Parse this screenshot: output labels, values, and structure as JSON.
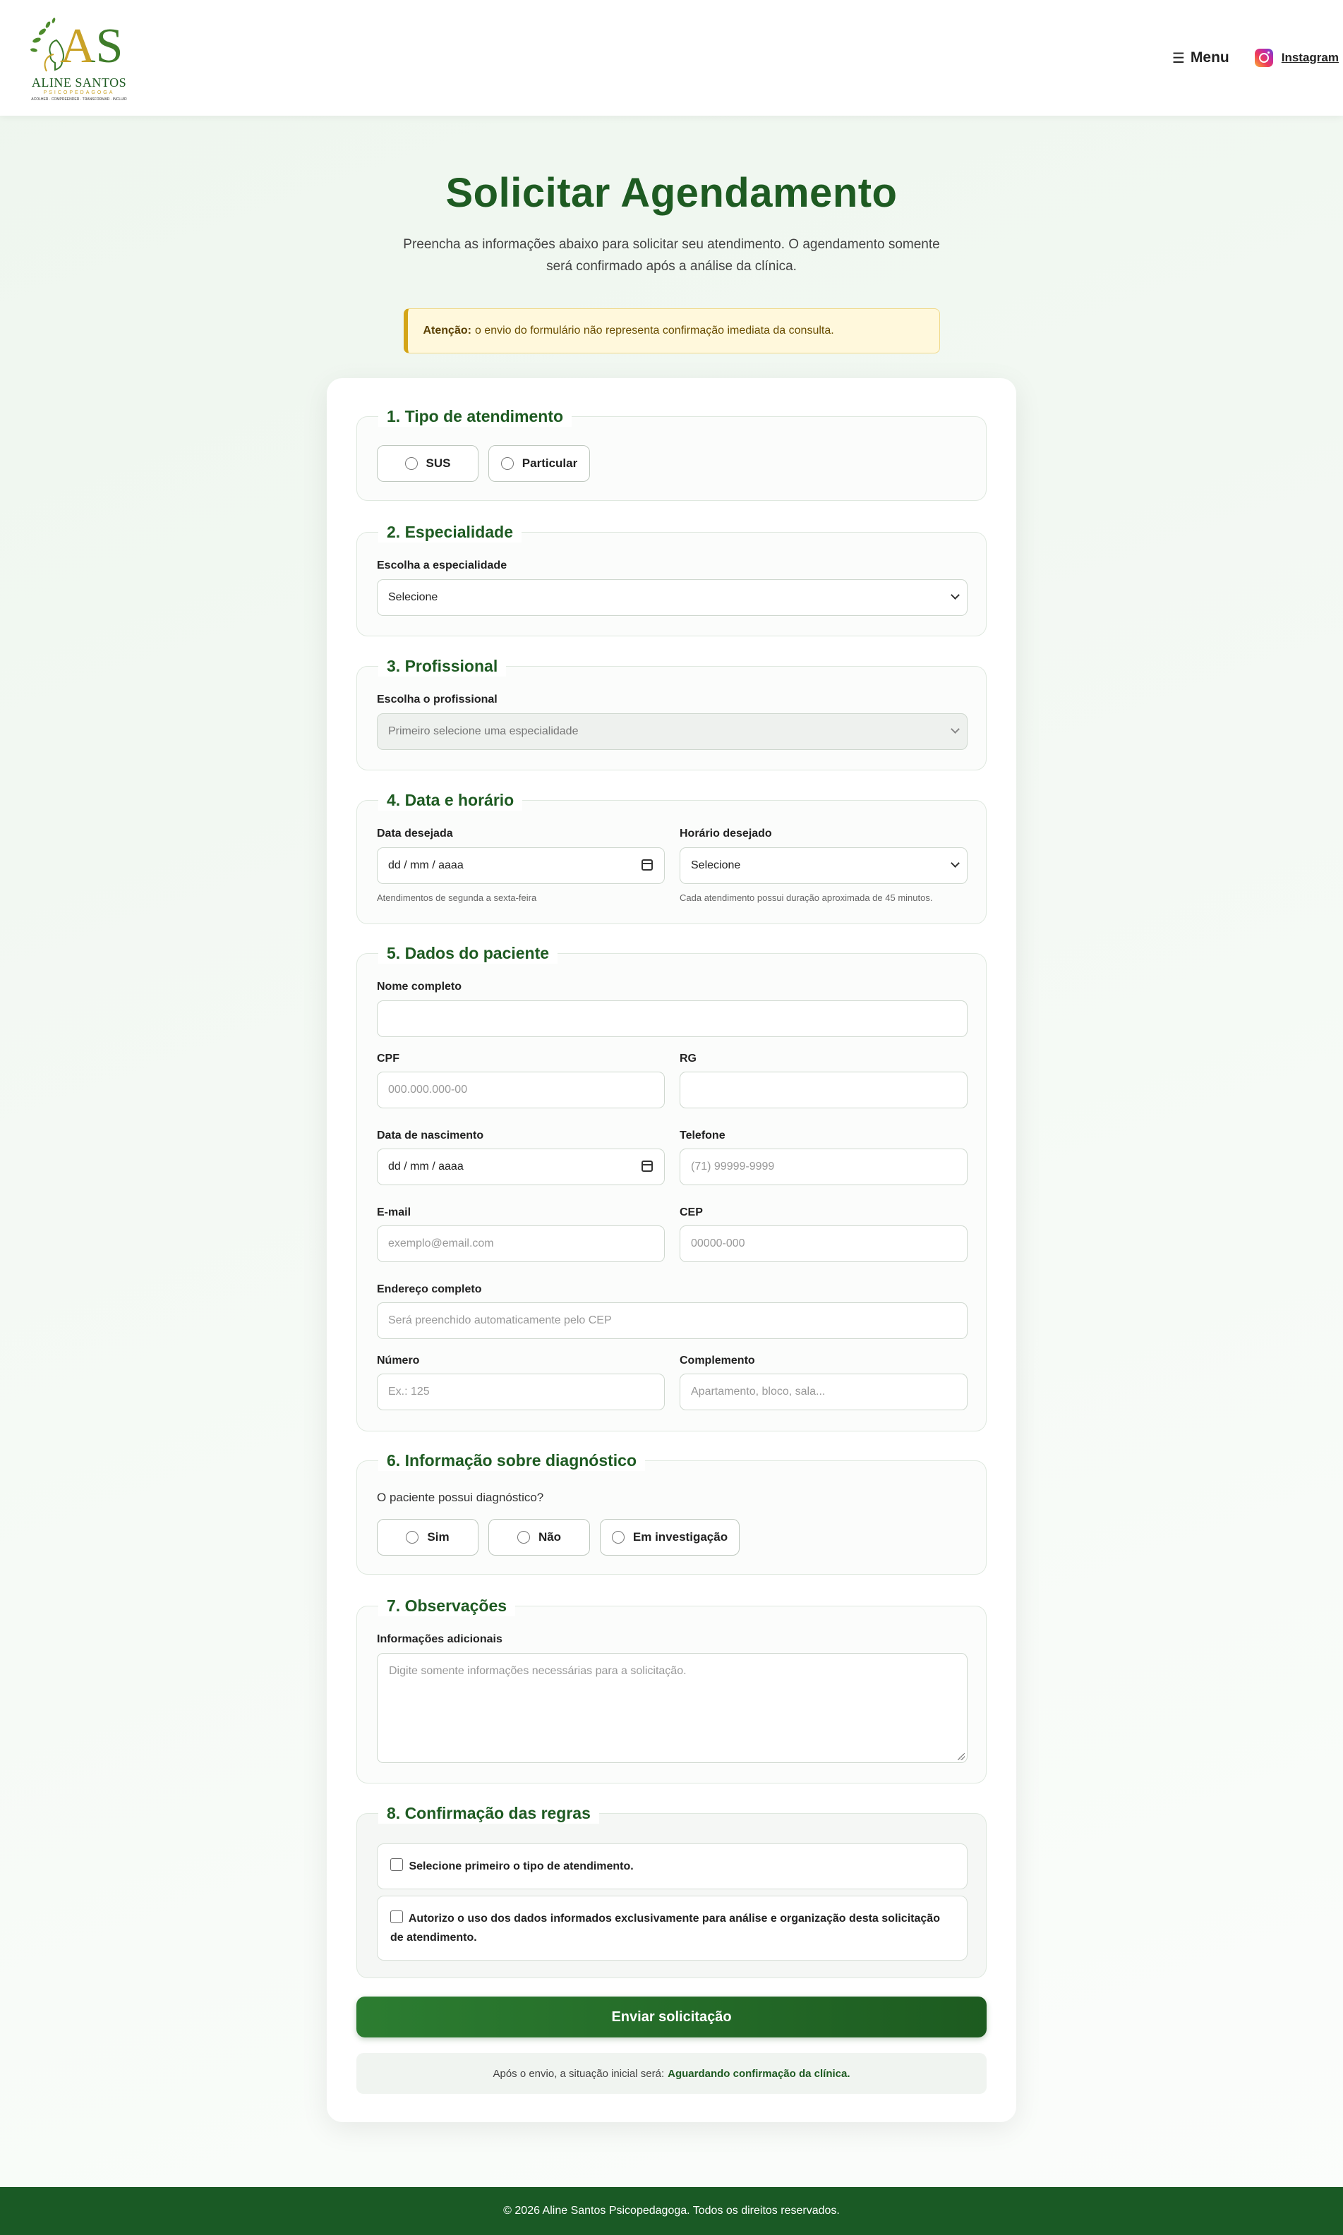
{
  "brand": {
    "logo_monogram": "AS",
    "logo_name": "ALINE SANTOS",
    "logo_tagline": "PSICOPEDAGOGA",
    "logo_values": "ACOLHER · COMPREENDER · TRANSFORMAR · INCLUIR",
    "colors": {
      "primary": "#1e5b22",
      "gold": "#c9a227",
      "footer": "#1a5a25"
    }
  },
  "nav": {
    "menu_icon": "hamburger-icon",
    "menu_label": "Menu",
    "instagram_label": "Instagram",
    "instagram_icon": "instagram-icon"
  },
  "hero": {
    "title": "Solicitar Agendamento",
    "subtitle": "Preencha as informações abaixo para solicitar seu atendimento. O agendamento somente será confirmado após a análise da clínica.",
    "alert_strong": "Atenção:",
    "alert_text": "o envio do formulário não representa confirmação imediata da consulta."
  },
  "form": {
    "s1": {
      "title": "1. Tipo de atendimento",
      "options": [
        "SUS",
        "Particular"
      ]
    },
    "s2": {
      "title": "2. Especialidade",
      "label": "Escolha a especialidade",
      "value": "Selecione"
    },
    "s3": {
      "title": "3. Profissional",
      "label": "Escolha o profissional",
      "value": "Primeiro selecione uma especialidade"
    },
    "s4": {
      "title": "4. Data e horário",
      "date_label": "Data desejada",
      "date_value": "dd / mm / aaaa",
      "date_hint": "Atendimentos de segunda a sexta-feira",
      "time_label": "Horário desejado",
      "time_value": "Selecione",
      "time_hint": "Cada atendimento possui duração aproximada de 45 minutos."
    },
    "s5": {
      "title": "5. Dados do paciente",
      "name_label": "Nome completo",
      "name_value": "",
      "cpf_label": "CPF",
      "cpf_placeholder": "000.000.000-00",
      "rg_label": "RG",
      "rg_value": "",
      "birth_label": "Data de nascimento",
      "birth_value": "dd / mm / aaaa",
      "phone_label": "Telefone",
      "phone_placeholder": "(71) 99999-9999",
      "email_label": "E-mail",
      "email_placeholder": "exemplo@email.com",
      "cep_label": "CEP",
      "cep_placeholder": "00000-000",
      "address_label": "Endereço completo",
      "address_placeholder": "Será preenchido automaticamente pelo CEP",
      "number_label": "Número",
      "number_placeholder": "Ex.: 125",
      "complement_label": "Complemento",
      "complement_placeholder": "Apartamento, bloco, sala..."
    },
    "s6": {
      "title": "6. Informação sobre diagnóstico",
      "question": "O paciente possui diagnóstico?",
      "options": [
        "Sim",
        "Não",
        "Em investigação"
      ]
    },
    "s7": {
      "title": "7. Observações",
      "label": "Informações adicionais",
      "placeholder": "Digite somente informações necessárias para a solicitação."
    },
    "s8": {
      "title": "8. Confirmação das regras",
      "check1": "Selecione primeiro o tipo de atendimento.",
      "check2": "Autorizo o uso dos dados informados exclusivamente para análise e organização desta solicitação de atendimento."
    },
    "submit_label": "Enviar solicitação",
    "status_prefix": "Após o envio, a situação inicial será:",
    "status_value": "Aguardando confirmação da clínica."
  },
  "footer": {
    "text": "© 2026 Aline Santos Psicopedagoga. Todos os direitos reservados."
  }
}
